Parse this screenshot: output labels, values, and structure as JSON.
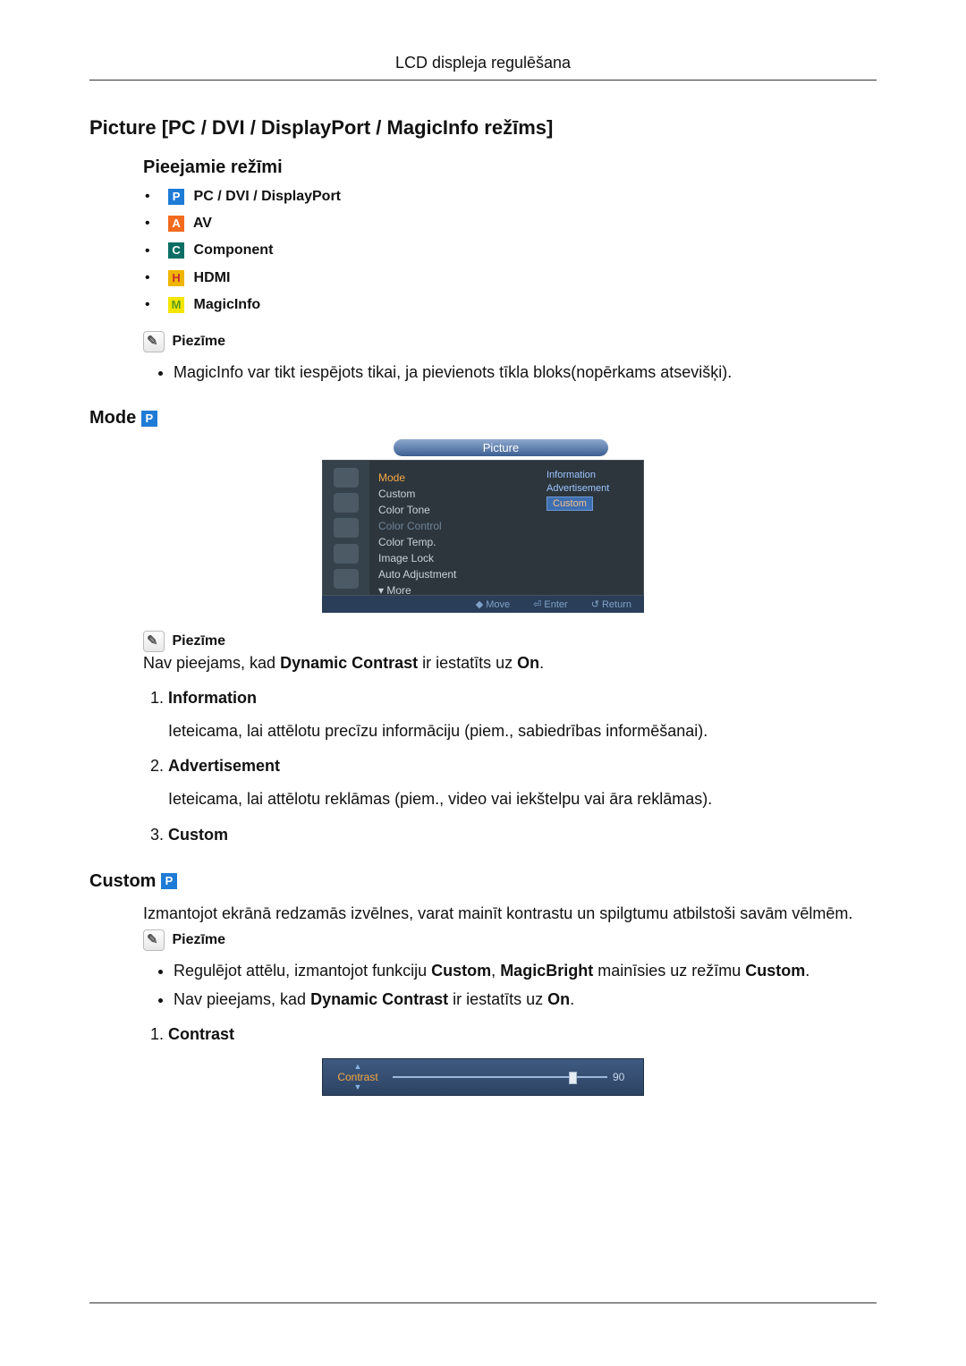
{
  "header": {
    "title": "LCD displeja regulēšana"
  },
  "section1": {
    "heading": "Picture [PC / DVI / DisplayPort / MagicInfo režīms]",
    "sub": "Pieejamie režīmi",
    "modes": [
      {
        "icon_letter": "P",
        "label": "PC / DVI / DisplayPort"
      },
      {
        "icon_letter": "A",
        "label": "AV"
      },
      {
        "icon_letter": "C",
        "label": "Component"
      },
      {
        "icon_letter": "H",
        "label": "HDMI"
      },
      {
        "icon_letter": "M",
        "label": "MagicInfo"
      }
    ],
    "note_title": "Piezīme",
    "note_items": [
      "MagicInfo var tikt iespējots tikai, ja pievienots tīkla bloks(nopērkams atsevišķi)."
    ]
  },
  "mode_section": {
    "heading": "Mode",
    "icon_letter": "P",
    "osd": {
      "title": "Picture",
      "menu": {
        "Mode": "Information",
        "items": [
          "Mode",
          "Custom",
          "Color Tone",
          "Color Control",
          "Color Temp.",
          "Image Lock",
          "Auto Adjustment",
          "▾ More"
        ],
        "highlight_index": 0,
        "dim_index": 3,
        "right_options": [
          "Information",
          "Advertisement",
          "Custom"
        ],
        "right_selected_index": 2
      },
      "footer": [
        "◆ Move",
        "⏎ Enter",
        "↺ Return"
      ]
    },
    "note_title": "Piezīme",
    "note_para_parts": [
      "Nav pieejams, kad ",
      "Dynamic Contrast",
      " ir iestatīts uz ",
      "On",
      "."
    ],
    "items": [
      {
        "title": "Information",
        "body": "Ieteicama, lai attēlotu precīzu informāciju (piem., sabiedrības informēšanai)."
      },
      {
        "title": "Advertisement",
        "body": "Ieteicama, lai attēlotu reklāmas (piem., video vai iekštelpu vai āra reklāmas)."
      },
      {
        "title": "Custom",
        "body": ""
      }
    ]
  },
  "custom_section": {
    "heading": "Custom",
    "icon_letter": "P",
    "intro": "Izmantojot ekrānā redzamās izvēlnes, varat mainīt kontrastu un spilgtumu atbilstoši savām vēlmēm.",
    "note_title": "Piezīme",
    "notes": [
      {
        "parts": [
          "Regulējot attēlu, izmantojot funkciju ",
          "Custom",
          ", ",
          "MagicBright",
          " mainīsies uz režīmu ",
          "Custom",
          "."
        ]
      },
      {
        "parts": [
          "Nav pieejams, kad ",
          "Dynamic Contrast",
          " ir iestatīts uz ",
          "On",
          "."
        ]
      }
    ],
    "numbered": [
      {
        "title": "Contrast"
      }
    ],
    "contrast_bar": {
      "label": "Contrast",
      "value": "90"
    }
  }
}
